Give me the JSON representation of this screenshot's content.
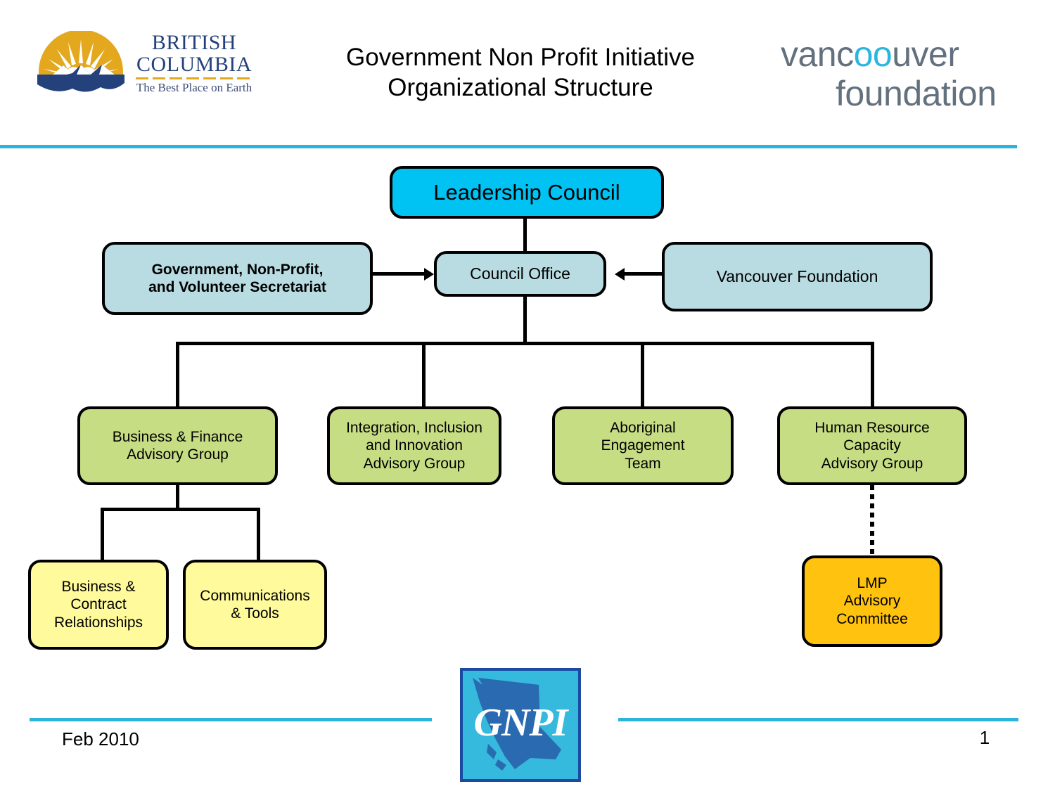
{
  "header": {
    "bc_logo": {
      "icon": "bc-sun-mountain-logo",
      "line1": "BRITISH",
      "line2": "COLUMBIA",
      "tagline": "The Best Place on Earth"
    },
    "title_line1": "Government Non Profit Initiative",
    "title_line2": "Organizational Structure",
    "vancouver_foundation": {
      "word1_a": "vanc",
      "word1_oo": "oo",
      "word1_b": "uver",
      "word2": "foundation"
    },
    "rule_color": "#2eb3dc"
  },
  "chart": {
    "leadership_council": "Leadership Council",
    "secretariat": "Government, Non-Profit,\nand Volunteer Secretariat",
    "council_office": "Council Office",
    "vancouver_foundation": "Vancouver Foundation",
    "advisory_groups": [
      "Business & Finance\nAdvisory Group",
      "Integration, Inclusion\nand Innovation\nAdvisory Group",
      "Aboriginal\nEngagement\nTeam",
      "Human Resource\nCapacity\nAdvisory Group"
    ],
    "subgroups": [
      "Business &\nContract\nRelationships",
      "Communications\n& Tools"
    ],
    "lmp": "LMP\nAdvisory\nCommittee",
    "colors": {
      "leadership": "#00c2f3",
      "support": "#b9dce2",
      "advisory": "#c7dd84",
      "subgroup": "#fffa9b",
      "lmp": "#ffc20e",
      "connector": "#000000"
    }
  },
  "footer": {
    "date": "Feb 2010",
    "page_number": "1",
    "logo_text": "GNPI"
  }
}
